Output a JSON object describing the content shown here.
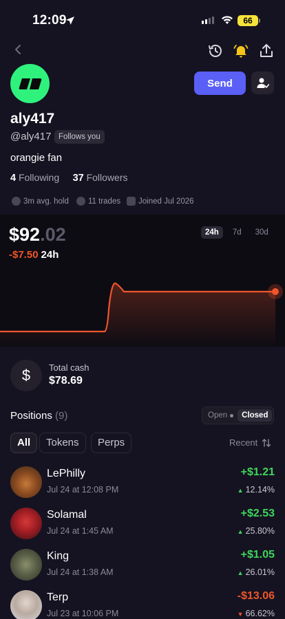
{
  "status_bar": {
    "time": "12:09",
    "battery": "66"
  },
  "profile": {
    "username": "aly417",
    "handle": "@aly417",
    "follows_badge": "Follows you",
    "bio": "orangie fan",
    "following_count": "4",
    "following_label": "Following",
    "followers_count": "37",
    "followers_label": "Followers",
    "avg_hold": "3m avg. hold",
    "trades": "11 trades",
    "joined": "Joined Jul 2026",
    "send_label": "Send",
    "avatar_color": "#2ff27d"
  },
  "portfolio": {
    "price_main": "$92",
    "price_cents": ".02",
    "change_value": "-$7.50",
    "change_period": "24h",
    "ranges": [
      "24h",
      "7d",
      "30d"
    ],
    "active_range": "24h",
    "line_color": "#f0552b"
  },
  "cash": {
    "label": "Total cash",
    "value": "$78.69",
    "symbol": "$"
  },
  "positions": {
    "title": "Positions",
    "count": "(9)",
    "toggle_open": "Open",
    "toggle_closed": "Closed",
    "filters": [
      "All",
      "Tokens",
      "Perps"
    ],
    "sort_label": "Recent",
    "items": [
      {
        "name": "LePhilly",
        "date": "Jul 24 at 12:08 PM",
        "pnl": "+$1.21",
        "pct": "12.14%",
        "dir": "up"
      },
      {
        "name": "Solamal",
        "date": "Jul 24 at 1:45 AM",
        "pnl": "+$2.53",
        "pct": "25.80%",
        "dir": "up"
      },
      {
        "name": "King",
        "date": "Jul 24 at 1:38 AM",
        "pnl": "+$1.05",
        "pct": "26.01%",
        "dir": "up"
      },
      {
        "name": "Terp",
        "date": "Jul 23 at 10:06 PM",
        "pnl": "-$13.06",
        "pct": "66.62%",
        "dir": "down"
      }
    ]
  }
}
